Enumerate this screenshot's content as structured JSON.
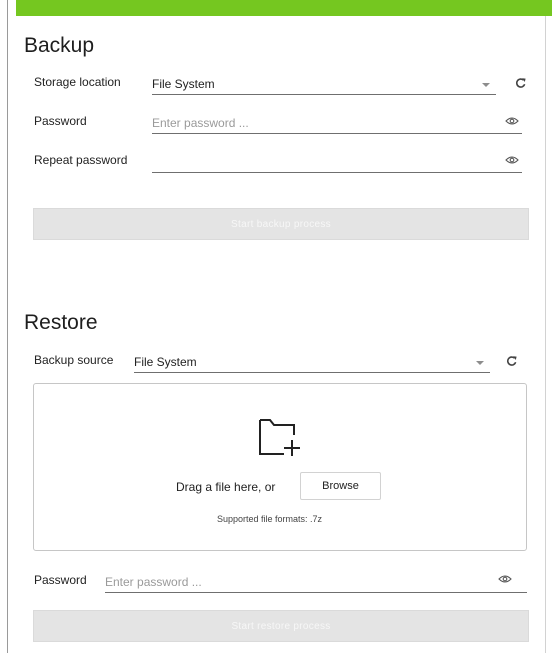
{
  "backup": {
    "title": "Backup",
    "storage_location_label": "Storage location",
    "storage_location_value": "File System",
    "password_label": "Password",
    "password_placeholder": "Enter password ...",
    "repeat_password_label": "Repeat password",
    "repeat_password_value": "",
    "start_button": "Start backup process"
  },
  "restore": {
    "title": "Restore",
    "backup_source_label": "Backup source",
    "backup_source_value": "File System",
    "drop_text": "Drag a file here, or",
    "browse_button": "Browse",
    "supported_formats": "Supported file formats: .7z",
    "password_label": "Password",
    "password_placeholder": "Enter password ...",
    "start_button": "Start restore process"
  },
  "colors": {
    "accent_bar": "#75c720",
    "disabled_button_bg": "#e4e4e4"
  },
  "icons": {
    "refresh": "refresh-icon",
    "eye": "eye-icon",
    "caret": "chevron-down-icon",
    "folder_add": "folder-plus-icon"
  }
}
